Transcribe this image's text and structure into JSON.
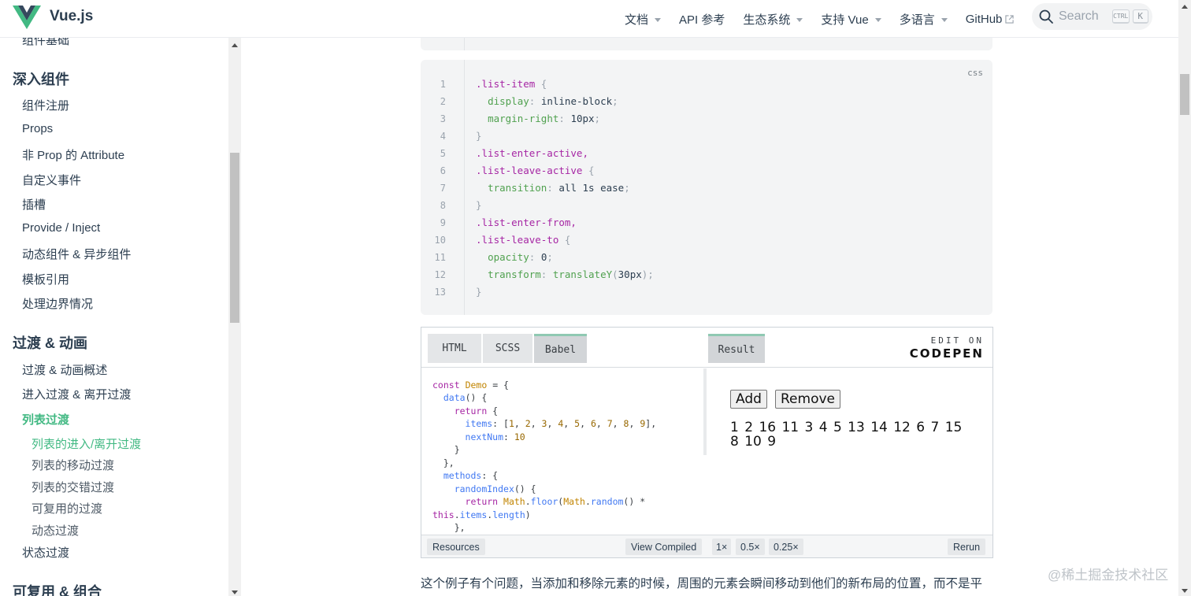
{
  "brand": {
    "name": "Vue.js",
    "logo_icon": "vue-logo-icon"
  },
  "nav": {
    "items": [
      {
        "label": "文档",
        "dropdown": true
      },
      {
        "label": "API 参考",
        "dropdown": false
      },
      {
        "label": "生态系统",
        "dropdown": true
      },
      {
        "label": "支持 Vue",
        "dropdown": true
      },
      {
        "label": "多语言",
        "dropdown": true
      },
      {
        "label": "GitHub",
        "external": true
      }
    ],
    "search": {
      "label": "Search",
      "kbd_ctrl": "CTRL",
      "kbd_k": "K"
    }
  },
  "sidebar": {
    "partial_item": "组件基础",
    "groups": [
      {
        "title": "深入组件",
        "items": [
          "组件注册",
          "Props",
          "非 Prop 的 Attribute",
          "自定义事件",
          "插槽",
          "Provide / Inject",
          "动态组件 & 异步组件",
          "模板引用",
          "处理边界情况"
        ]
      },
      {
        "title": "过渡 & 动画",
        "items": [
          "过渡 & 动画概述",
          "进入过渡 & 离开过渡",
          "列表过渡"
        ],
        "active_item": "列表过渡",
        "sub_items": [
          "列表的进入/离开过渡",
          "列表的移动过渡",
          "列表的交错过渡",
          "可复用的过渡",
          "动态过渡"
        ],
        "active_sub_item": "列表的进入/离开过渡",
        "after_items": [
          "状态过渡"
        ]
      },
      {
        "title": "可复用 & 组合"
      }
    ]
  },
  "code_block": {
    "lang": "css",
    "line_numbers": [
      "1",
      "2",
      "3",
      "4",
      "5",
      "6",
      "7",
      "8",
      "9",
      "10",
      "11",
      "12",
      "13"
    ]
  },
  "codepen": {
    "tabs": [
      "HTML",
      "SCSS",
      "Babel"
    ],
    "active_tab": "Babel",
    "result_tab": "Result",
    "edit_on": "EDIT ON",
    "codepen_brand": "CODEPEN",
    "result": {
      "add_label": "Add",
      "remove_label": "Remove",
      "numbers": "1 2 16 11 3 4 5 13 14 12 6 7 15 8 10 9"
    },
    "footer": {
      "resources": "Resources",
      "view_compiled": "View Compiled",
      "zoom": [
        "1×",
        "0.5×",
        "0.25×"
      ],
      "rerun": "Rerun"
    }
  },
  "paragraph": "这个例子有个问题，当添加和移除元素的时候，周围的元素会瞬间移动到他们的新布局的位置，而不是平",
  "watermark": "@稀土掘金技术社区",
  "colors": {
    "accent": "#42b983",
    "text": "#2c3e50",
    "code_bg": "#f3f4f5"
  }
}
